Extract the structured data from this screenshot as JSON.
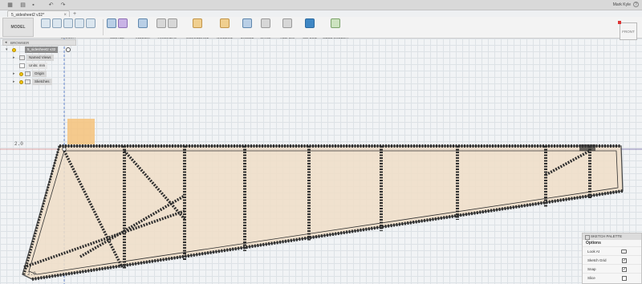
{
  "tabbar": {
    "doc_tab": "5_sidesheet2 v32*",
    "user": "Mark Kyle",
    "help": "?"
  },
  "ribbon": {
    "workspace": "MODEL",
    "groups": [
      "SKETCH",
      "CREATE",
      "MODIFY",
      "ASSEMBLE",
      "CONSTRUCT",
      "INSPECT",
      "INSERT",
      "MAKE",
      "ADD-INS",
      "SELECT",
      "STOP SKETCH"
    ]
  },
  "viewcube": {
    "label": "FRONT"
  },
  "browser": {
    "title": "BROWSER",
    "root": "5_sidesheet2 v32",
    "items": [
      "Named Views",
      "Units: mm",
      "Origin",
      "Sketches"
    ]
  },
  "canvas": {
    "dim_left": "2.0",
    "dim_bottom": "2.0"
  },
  "palette": {
    "title": "SKETCH PALETTE",
    "section": "Options",
    "rows": [
      "Look At",
      "Sketch Grid",
      "Snap",
      "Slice"
    ],
    "checked": [
      null,
      true,
      true,
      false
    ]
  },
  "colors": {
    "sheet_fill": "#f0dfc8",
    "sketch_line": "#2f2f2f",
    "origin_square": "#f6c27a"
  }
}
